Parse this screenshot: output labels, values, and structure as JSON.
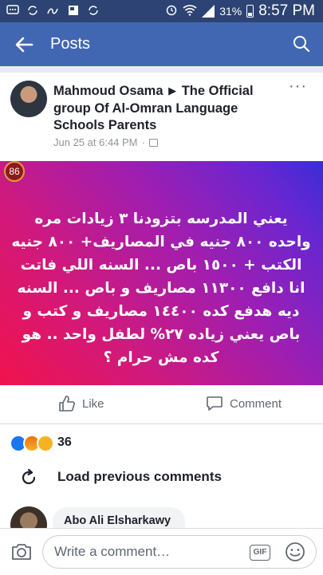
{
  "status_bar": {
    "battery": "31%",
    "time": "8:57 PM"
  },
  "app_bar": {
    "title": "Posts"
  },
  "post": {
    "author": "Mahmoud Osama",
    "group": "The Official group Of Al-Omran Language Schools Parents",
    "timestamp": "Jun 25 at 6:44 PM",
    "more": "···",
    "badge_count": "86",
    "text": "يعني المدرسه بتزودنا ٣ زيادات مره واحده ٨٠٠ جنيه في المصاريف+ ٨٠٠ جنيه الكتب + ١٥٠٠ باص ... السنه اللي فاتت انا دافع ١١٣٠٠ مصاريف و باص ... السنه ديه هدفع كده ١٤٤٠٠ مصاريف و كتب و باص يعني زياده ٢٧% لطفل واحد .. هو كده مش حرام ؟",
    "banner_colors": [
      "#f0134d",
      "#a01eb0",
      "#3a2dd6"
    ],
    "actions": {
      "like": "Like",
      "comment": "Comment"
    }
  },
  "reactions": {
    "types": [
      "like",
      "angry",
      "sad"
    ],
    "count": "36"
  },
  "comments": {
    "load_previous": "Load previous comments",
    "items": [
      {
        "name": "Abo Ali Elsharkawy"
      }
    ]
  },
  "composer": {
    "placeholder": "Write a comment…",
    "gif_label": "GIF"
  }
}
